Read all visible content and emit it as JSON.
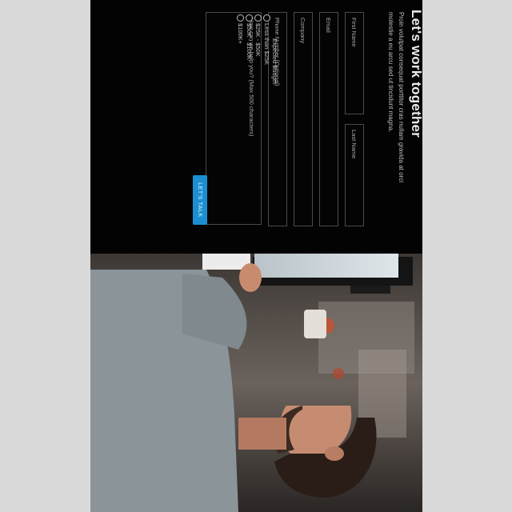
{
  "hero": {
    "title": "Let's work together",
    "intro": "Proin volutpat consequat porttitor cras nullam gravida at orci molestie a eu arcu sed ut tincidunt magna."
  },
  "form": {
    "first_name_label": "First Name",
    "last_name_label": "Last Name",
    "email_label": "Email",
    "company_label": "Company",
    "phone_label": "Phone Number (Optional)",
    "message_placeholder": "How can we help you? (Max 500 characters)",
    "budget": {
      "title": "Expected Budget",
      "options": [
        "Less than $25K",
        "$25K - $50K",
        "$50K - $100K",
        "$100K+"
      ]
    },
    "submit_label": "LET'S TALK"
  },
  "photo": {
    "subject": "man-working-at-computer"
  },
  "colors": {
    "panel_background": "#030303",
    "accent": "#1b8fd1",
    "page_background": "#d9d9d9"
  }
}
